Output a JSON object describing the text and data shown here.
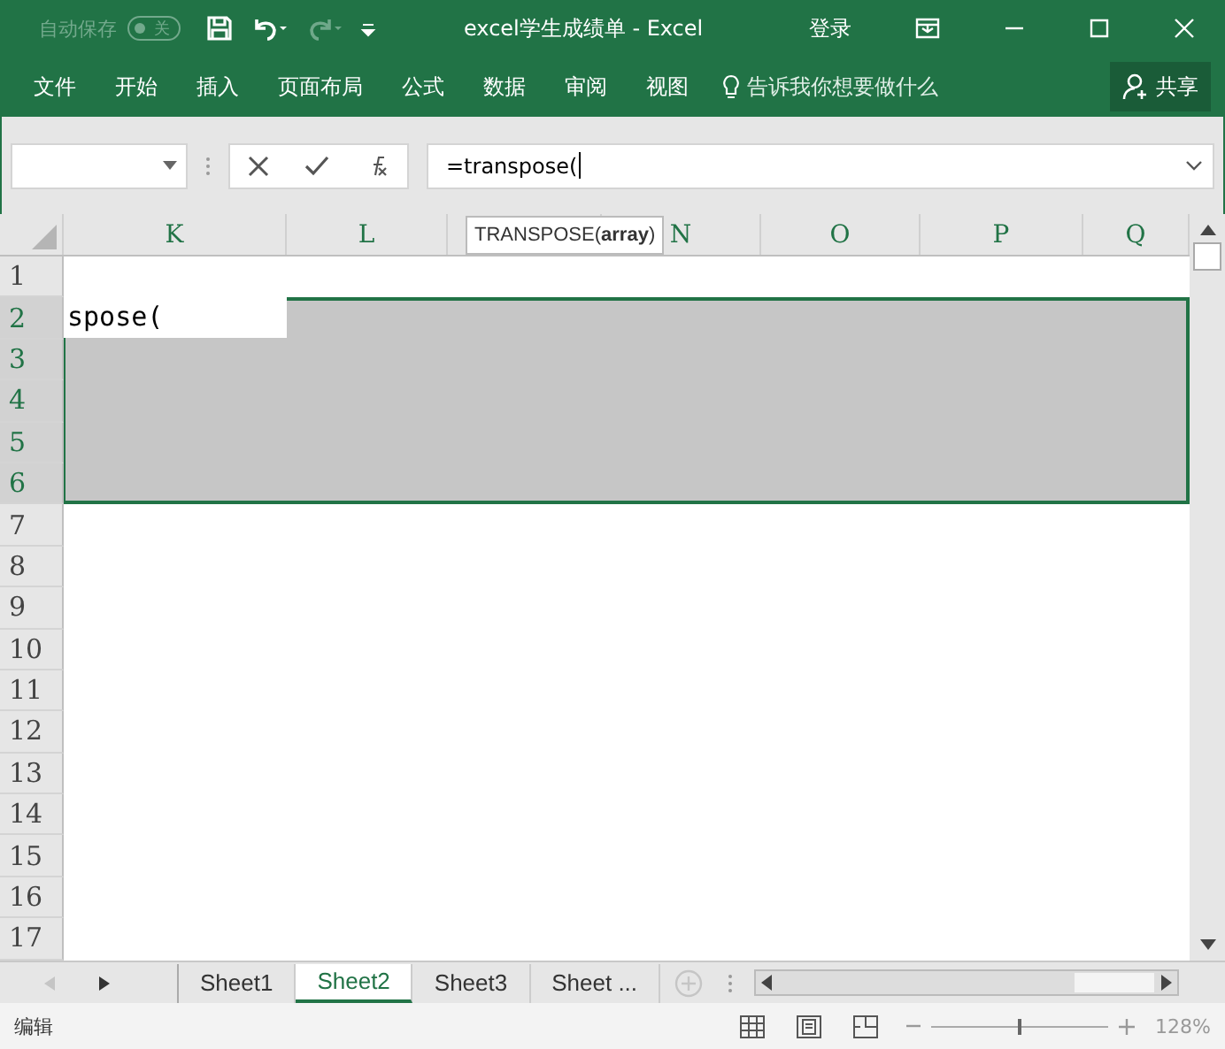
{
  "title_bar": {
    "autosave": {
      "label": "自动保存",
      "toggle_label": "关",
      "on": false
    },
    "title": "excel学生成绩单  -  Excel",
    "sign_in": "登录"
  },
  "ribbon_tabs": [
    "文件",
    "开始",
    "插入",
    "页面布局",
    "公式",
    "数据",
    "审阅",
    "视图"
  ],
  "tell_me": {
    "placeholder": "告诉我你想要做什么"
  },
  "share": "共享",
  "formula_bar": {
    "formula": "=transpose("
  },
  "tooltip": "TRANSPOSE(**array**)",
  "columns": [
    {
      "label": "K"
    },
    {
      "label": "L"
    },
    {},
    {
      "label": "N"
    },
    {
      "label": "O"
    },
    {
      "label": "P"
    },
    {
      "label": "Q"
    }
  ],
  "rows": [
    {
      "label": "1",
      "selected": false
    },
    {
      "label": "2",
      "selected": true,
      "value": "spose("
    },
    {
      "label": "3",
      "selected": true
    },
    {
      "label": "4",
      "selected": true
    },
    {
      "label": "5",
      "selected": true
    },
    {
      "label": "6",
      "selected": true
    },
    {
      "label": "7",
      "selected": false
    },
    {
      "label": "8",
      "selected": false
    },
    {
      "label": "9",
      "selected": false
    },
    {
      "label": "10",
      "selected": false
    },
    {
      "label": "11",
      "selected": false
    },
    {
      "label": "12",
      "selected": false
    },
    {
      "label": "13",
      "selected": false
    },
    {
      "label": "14",
      "selected": false
    },
    {
      "label": "15",
      "selected": false
    },
    {
      "label": "16",
      "selected": false
    },
    {
      "label": "17",
      "selected": false
    }
  ],
  "sheet_tabs": [
    {
      "label": "Sheet1",
      "selected": false
    },
    {
      "label": "Sheet2",
      "selected": true
    },
    {
      "label": "Sheet3",
      "selected": false
    },
    {
      "label": "Sheet ...",
      "selected": false
    }
  ],
  "status_bar": {
    "mode": "编辑",
    "zoom": {
      "level": 0.5,
      "reading": "128%"
    }
  }
}
